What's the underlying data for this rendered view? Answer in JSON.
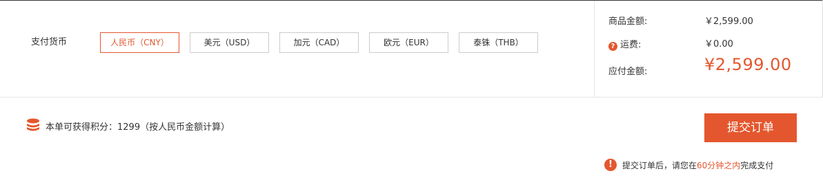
{
  "currency": {
    "label": "支付货币",
    "options": [
      {
        "label": "人民币（CNY）",
        "selected": true
      },
      {
        "label": "美元（USD）",
        "selected": false
      },
      {
        "label": "加元（CAD）",
        "selected": false
      },
      {
        "label": "欧元（EUR）",
        "selected": false
      },
      {
        "label": "泰铢（THB）",
        "selected": false
      }
    ]
  },
  "summary": {
    "goods_label": "商品金额:",
    "goods_value": "￥2,599.00",
    "shipping_label": "运费:",
    "shipping_help_icon": "?",
    "shipping_value": "￥0.00",
    "payable_label": "应付金额:",
    "payable_value": "¥2,599.00"
  },
  "points": {
    "text": "本单可获得积分：1299（按人民币金额计算）"
  },
  "submit": {
    "label": "提交订单"
  },
  "notice": {
    "icon": "!",
    "prefix": "提交订单后，请您在",
    "highlight": "60分钟之内",
    "suffix": "完成支付"
  },
  "colors": {
    "accent": "#e4572e",
    "border": "#cccccc",
    "text": "#333333"
  }
}
